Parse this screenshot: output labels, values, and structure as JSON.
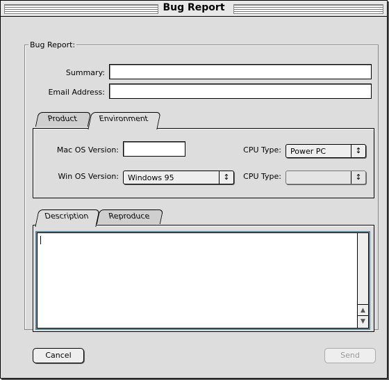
{
  "window": {
    "title": "Bug Report"
  },
  "group": {
    "label": "Bug Report:"
  },
  "form": {
    "summary_label": "Summary:",
    "summary_value": "",
    "email_label": "Email Address:",
    "email_value": ""
  },
  "top_tabs": [
    {
      "label": "Product",
      "selected": false
    },
    {
      "label": "Environment",
      "selected": true
    }
  ],
  "environment": {
    "mac_os_label": "Mac OS Version:",
    "mac_os_value": "",
    "cpu_type_label_1": "CPU Type:",
    "cpu_type_value_1": "Power PC",
    "win_os_label": "Win OS Version:",
    "win_os_value": "Windows 95",
    "cpu_type_label_2": "CPU Type:",
    "cpu_type_value_2": ""
  },
  "bottom_tabs": [
    {
      "label": "Description",
      "selected": true
    },
    {
      "label": "Reproduce",
      "selected": false
    }
  ],
  "description": {
    "text": ""
  },
  "buttons": {
    "cancel": "Cancel",
    "send": "Send"
  },
  "icons": {
    "popup_arrow": "updown-arrows-icon",
    "scroll_up": "scroll-up-arrow-icon",
    "scroll_down": "scroll-down-arrow-icon"
  },
  "colors": {
    "window_bg": "#dddddd",
    "focus_ring": "#5a8a9a"
  }
}
